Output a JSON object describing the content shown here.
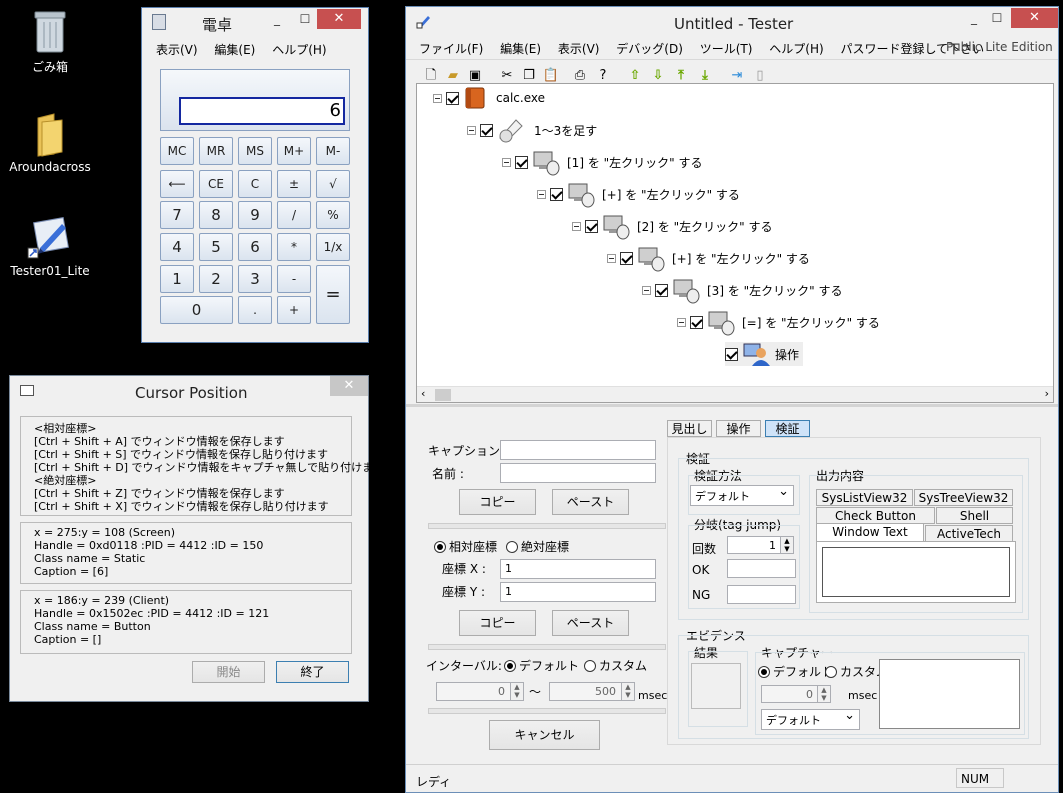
{
  "desktop": {
    "icons": [
      {
        "label": "ごみ箱"
      },
      {
        "label": "Aroundacross"
      },
      {
        "label": "Tester01_Lite"
      }
    ]
  },
  "calculator": {
    "title": "電卓",
    "menu": [
      "表示(V)",
      "編集(E)",
      "ヘルプ(H)"
    ],
    "display": "6",
    "buttons": {
      "mc": "MC",
      "mr": "MR",
      "ms": "MS",
      "mplus": "M+",
      "mminus": "M-",
      "back": "⟵",
      "ce": "CE",
      "c": "C",
      "pm": "±",
      "sqrt": "√",
      "n7": "7",
      "n8": "8",
      "n9": "9",
      "div": "/",
      "pct": "%",
      "n4": "4",
      "n5": "5",
      "n6": "6",
      "mul": "*",
      "inv": "1/x",
      "n1": "1",
      "n2": "2",
      "n3": "3",
      "sub": "-",
      "eq": "=",
      "n0": "0",
      "dot": ".",
      "add": "+"
    }
  },
  "cursor_position": {
    "title": "Cursor Position",
    "help_text": "<相対座標>\n[Ctrl + Shift + A] でウィンドウ情報を保存します\n[Ctrl + Shift + S] でウィンドウ情報を保存し貼り付けます\n[Ctrl + Shift + D] でウィンドウ情報をキャプチャ無しで貼り付けます\n<絶対座標>\n[Ctrl + Shift + Z] でウィンドウ情報を保存します\n[Ctrl + Shift + X] でウィンドウ情報を保存し貼り付けます",
    "screen_info": "x = 275:y = 108 (Screen)\nHandle = 0xd0118 :PID = 4412 :ID = 150\nClass name = Static\nCaption = [6]",
    "client_info": "x = 186:y = 239 (Client)\nHandle = 0x1502ec :PID = 4412 :ID = 121\nClass name = Button\nCaption = []",
    "start_label": "開始",
    "end_label": "終了"
  },
  "tester": {
    "title": "Untitled - Tester",
    "menu": [
      "ファイル(F)",
      "編集(E)",
      "表示(V)",
      "デバッグ(D)",
      "ツール(T)",
      "ヘルプ(H)",
      "パスワード登録して下さい"
    ],
    "edition": "Public Lite Edition",
    "tree": [
      {
        "label": "calc.exe"
      },
      {
        "label": "1～3を足す"
      },
      {
        "label": "[1] を \"左クリック\" する"
      },
      {
        "label": "[+] を \"左クリック\" する"
      },
      {
        "label": "[2] を \"左クリック\" する"
      },
      {
        "label": "[+] を \"左クリック\" する"
      },
      {
        "label": "[3] を \"左クリック\" する"
      },
      {
        "label": "[=] を \"左クリック\" する"
      },
      {
        "label": "操作"
      }
    ],
    "form": {
      "caption_label": "キャプション:",
      "name_label": "名前 :",
      "copy_label": "コピー",
      "paste_label": "ペースト",
      "relative_label": "相対座標",
      "absolute_label": "絶対座標",
      "x_label": "座標 X :",
      "y_label": "座標 Y :",
      "x_value": "1",
      "y_value": "1",
      "copy2_label": "コピー",
      "paste2_label": "ペースト",
      "interval_label": "インターバル:",
      "default_label": "デフォルト",
      "custom_label": "カスタム",
      "interval_from": "0",
      "interval_sep": "～",
      "interval_to": "500",
      "msec": "msec",
      "cancel_label": "キャンセル"
    },
    "tabs": [
      "見出し",
      "操作",
      "検証"
    ],
    "verify": {
      "group_label": "検証",
      "method_label": "検証方法",
      "method_value": "デフォルト",
      "branch_label": "分岐(tag jump)",
      "count_label": "回数",
      "count_value": "1",
      "ok_label": "OK",
      "ng_label": "NG",
      "output_label": "出力内容",
      "output_tabs": [
        "SysListView32",
        "SysTreeView32",
        "Check Button",
        "Shell",
        "Window Text",
        "ActiveTech"
      ]
    },
    "evidence": {
      "group_label": "エビデンス",
      "result_label": "結果",
      "capture_label": "キャプチャー",
      "default_label": "デフォルト",
      "custom_label": "カスタム",
      "msec_value": "0",
      "msec": "msec",
      "select_value": "デフォルト"
    },
    "status": {
      "text": "レディ",
      "num": "NUM"
    }
  }
}
